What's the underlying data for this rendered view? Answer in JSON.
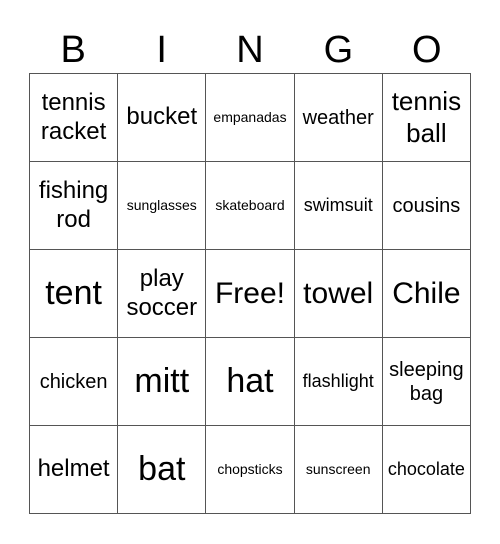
{
  "header": [
    "B",
    "I",
    "N",
    "G",
    "O"
  ],
  "cells": [
    [
      "tennis racket",
      "bucket",
      "empanadas",
      "weather",
      "tennis ball"
    ],
    [
      "fishing rod",
      "sunglasses",
      "skateboard",
      "swimsuit",
      "cousins"
    ],
    [
      "tent",
      "play soccer",
      "Free!",
      "towel",
      "Chile"
    ],
    [
      "chicken",
      "mitt",
      "hat",
      "flashlight",
      "sleeping bag"
    ],
    [
      "helmet",
      "bat",
      "chopsticks",
      "sunscreen",
      "chocolate"
    ]
  ]
}
